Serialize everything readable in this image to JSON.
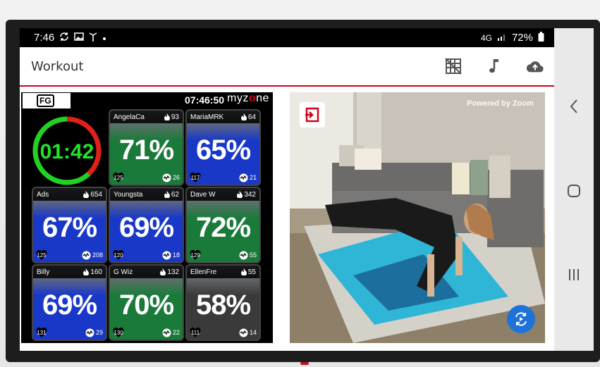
{
  "status_bar": {
    "time": "7:46",
    "network": "4G",
    "battery": "72%"
  },
  "app_bar": {
    "title": "Workout"
  },
  "myzone": {
    "brand_badge": "FG",
    "clock": "07:46:50",
    "logo_prefix": "myz",
    "logo_accent": "o",
    "logo_suffix": "ne",
    "timer": {
      "value": "01:42",
      "progress": 0.62,
      "ring_color": "#1fd324",
      "remaining_color": "#e0211a"
    },
    "tiles": [
      {
        "name": "AngelaCa",
        "kcal": "93",
        "pct": "71%",
        "hr": "125",
        "meps": "26",
        "color": "#1a7a3a"
      },
      {
        "name": "MariaMRK",
        "kcal": "64",
        "pct": "65%",
        "hr": "117",
        "meps": "21",
        "color": "#1a38c8"
      },
      {
        "name": "Ads",
        "kcal": "654",
        "pct": "67%",
        "hr": "125",
        "meps": "208",
        "color": "#1a38c8"
      },
      {
        "name": "Youngsta",
        "kcal": "62",
        "pct": "69%",
        "hr": "120",
        "meps": "18",
        "color": "#1a38c8"
      },
      {
        "name": "Dave W",
        "kcal": "342",
        "pct": "72%",
        "hr": "129",
        "meps": "55",
        "color": "#1a7a3a"
      },
      {
        "name": "Billy",
        "kcal": "160",
        "pct": "69%",
        "hr": "131",
        "meps": "29",
        "color": "#1a38c8"
      },
      {
        "name": "G Wiz",
        "kcal": "132",
        "pct": "70%",
        "hr": "130",
        "meps": "22",
        "color": "#1a7a3a"
      },
      {
        "name": "EllenFre",
        "kcal": "55",
        "pct": "58%",
        "hr": "111",
        "meps": "14",
        "color": "#3a3a3a"
      }
    ]
  },
  "video": {
    "label": "Powered by Zoom"
  },
  "icons": {
    "grid_toggle": "grid-off-icon",
    "music": "music-note-icon",
    "cloud": "cloud-upload-icon",
    "exit": "exit-icon",
    "switch_camera": "switch-camera-icon",
    "back": "back-icon",
    "home": "home-icon",
    "recents": "recents-icon"
  }
}
